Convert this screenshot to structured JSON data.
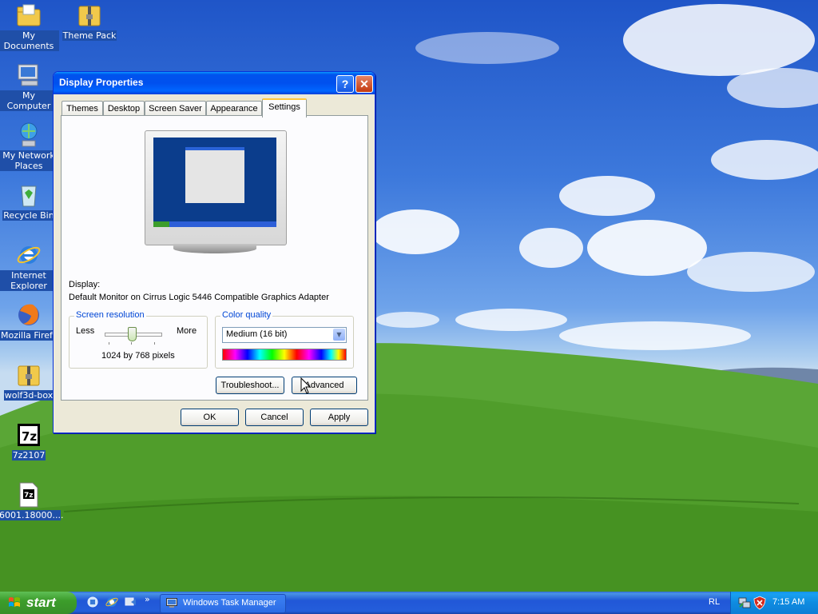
{
  "desktop": {
    "icons": [
      {
        "label": "My Documents",
        "icon": "folder-icon"
      },
      {
        "label": "Theme Pack",
        "icon": "zip-folder-icon"
      },
      {
        "label": "My Computer",
        "icon": "computer-icon"
      },
      {
        "label": "My Network Places",
        "icon": "network-icon"
      },
      {
        "label": "Recycle Bin",
        "icon": "recycle-bin-icon"
      },
      {
        "label": "Internet Explorer",
        "icon": "ie-icon"
      },
      {
        "label": "Mozilla Firefox",
        "icon": "firefox-icon"
      },
      {
        "label": "wolf3d-box",
        "icon": "zip-folder-icon"
      },
      {
        "label": "7z2107",
        "icon": "7zip-icon"
      },
      {
        "label": "6001.18000....",
        "icon": "7z-file-icon"
      }
    ]
  },
  "dialog": {
    "title": "Display Properties",
    "help_glyph": "?",
    "close_glyph": "✕",
    "tabs": [
      "Themes",
      "Desktop",
      "Screen Saver",
      "Appearance",
      "Settings"
    ],
    "active_tab": "Settings",
    "display_label": "Display:",
    "display_value": "Default Monitor on Cirrus Logic 5446 Compatible Graphics Adapter",
    "resolution": {
      "legend": "Screen resolution",
      "less": "Less",
      "more": "More",
      "value_text": "1024 by 768 pixels"
    },
    "color_quality": {
      "legend": "Color quality",
      "selected": "Medium (16 bit)"
    },
    "buttons": {
      "troubleshoot": "Troubleshoot...",
      "advanced": "Advanced",
      "ok": "OK",
      "cancel": "Cancel",
      "apply": "Apply"
    }
  },
  "taskbar": {
    "start_label": "start",
    "quick_launch_more": "»",
    "task": "Windows Task Manager",
    "language": "RL",
    "clock": "7:15 AM"
  },
  "colors": {
    "titlebar": "#0053ee",
    "start_green": "#3c9d2b",
    "accent_tab": "#ffc73c"
  }
}
